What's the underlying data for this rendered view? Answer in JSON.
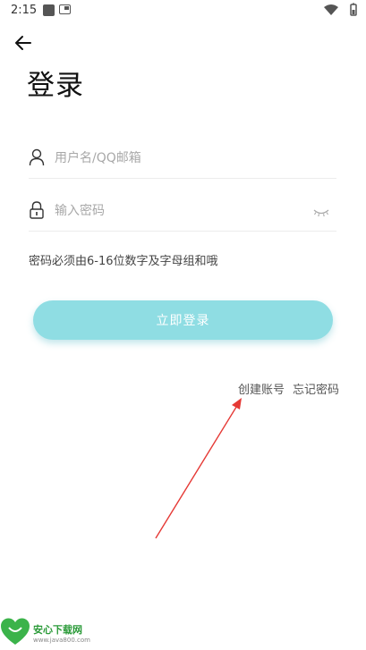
{
  "status_bar": {
    "time": "2:15"
  },
  "header": {
    "title": "登录"
  },
  "form": {
    "username_placeholder": "用户名/QQ邮箱",
    "password_placeholder": "输入密码",
    "hint": "密码必须由6-16位数字及字母组和哦"
  },
  "actions": {
    "login_label": "立即登录",
    "create_account_label": "创建账号",
    "forgot_password_label": "忘记密码"
  },
  "watermark": {
    "name": "安心下载网",
    "url": "www.java800.com"
  },
  "colors": {
    "login_button": "#8fdde3",
    "annotation_arrow": "#e53935",
    "watermark_green": "#2a9a38"
  },
  "icons": [
    "back-arrow-icon",
    "user-icon",
    "lock-icon",
    "eye-closed-icon",
    "wifi-icon",
    "battery-icon"
  ]
}
